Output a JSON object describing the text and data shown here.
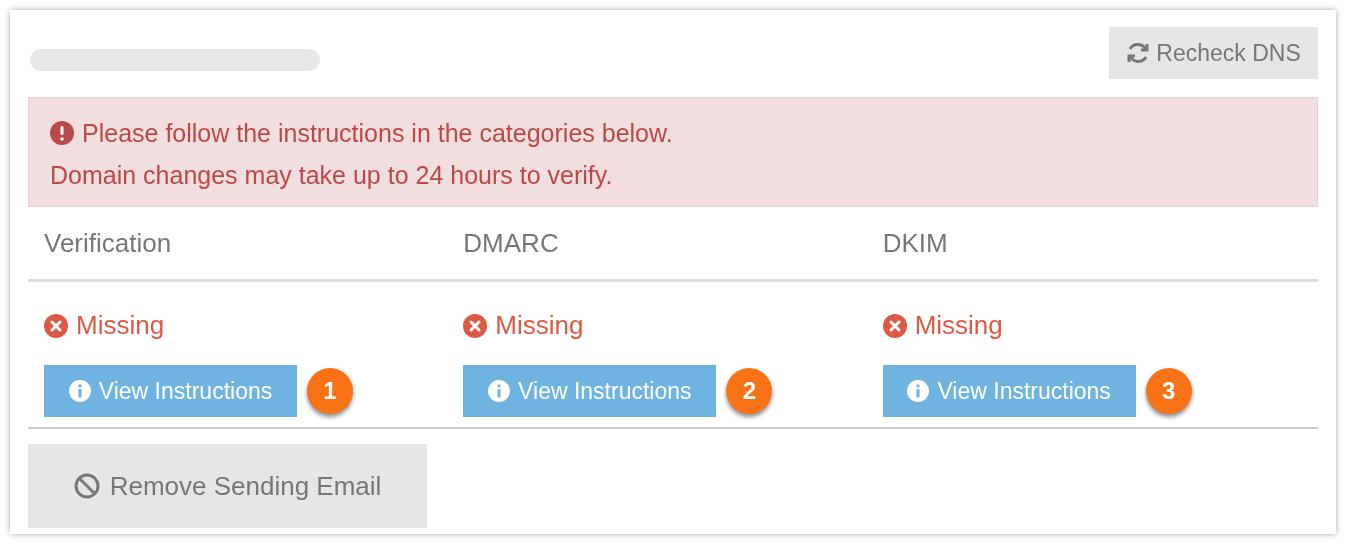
{
  "recheck_button": "Recheck DNS",
  "alert": {
    "lines": [
      "Please follow the instructions in the categories below.",
      "Domain changes may take up to 24 hours to verify."
    ]
  },
  "categories": [
    {
      "heading": "Verification",
      "status": {
        "kind": "missing",
        "label": "Missing"
      },
      "button": "View Instructions",
      "step": "1"
    },
    {
      "heading": "DMARC",
      "status": {
        "kind": "missing",
        "label": "Missing"
      },
      "button": "View Instructions",
      "step": "2"
    },
    {
      "heading": "DKIM",
      "status": {
        "kind": "missing",
        "label": "Missing"
      },
      "button": "View Instructions",
      "step": "3"
    }
  ],
  "remove_button": "Remove Sending Email"
}
